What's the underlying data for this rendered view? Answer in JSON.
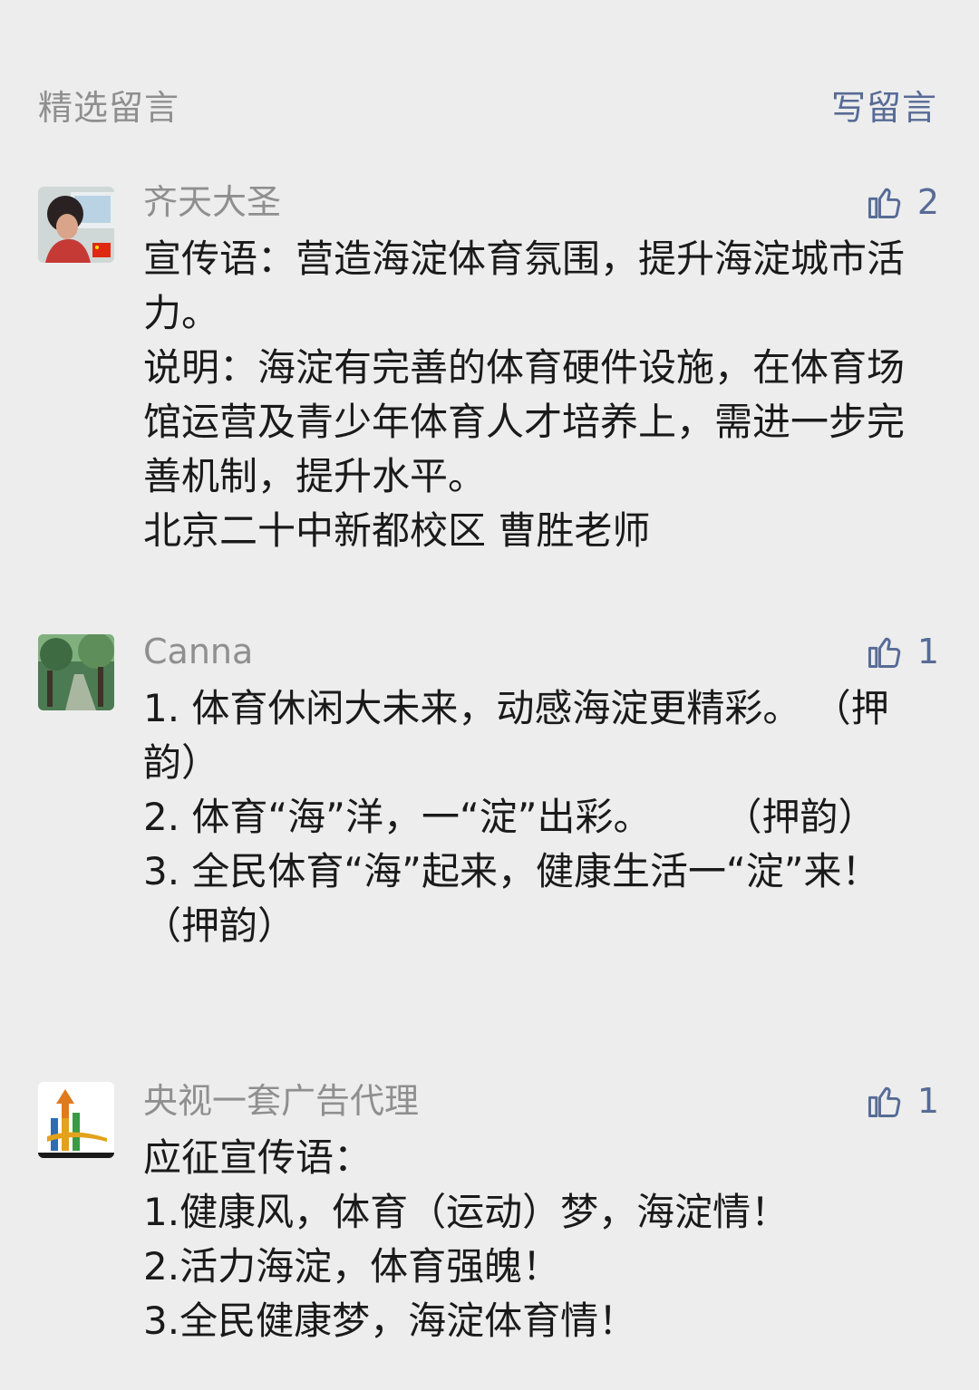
{
  "header": {
    "title": "精选留言",
    "write_label": "写留言"
  },
  "comments": [
    {
      "nickname": "齐天大圣",
      "likes": "2",
      "text": "宣传语：营造海淀体育氛围，提升海淀城市活力。\n说明：海淀有完善的体育硬件设施，在体育场馆运营及青少年体育人才培养上，需进一步完善机制，提升水平。\n北京二十中新都校区 曹胜老师"
    },
    {
      "nickname": "Canna",
      "likes": "1",
      "text": "1. 体育休闲大未来，动感海淀更精彩。 （押韵）\n2. 体育“海”洋，一“淀”出彩。      （押韵）\n3. 全民体育“海”起来，健康生活一“淀”来！ （押韵）"
    },
    {
      "nickname": "央视一套广告代理",
      "likes": "1",
      "text": "应征宣传语：\n1.健康风，体育（运动）梦，海淀情！\n2.活力海淀，体育强魄！\n3.全民健康梦，海淀体育情！"
    }
  ]
}
